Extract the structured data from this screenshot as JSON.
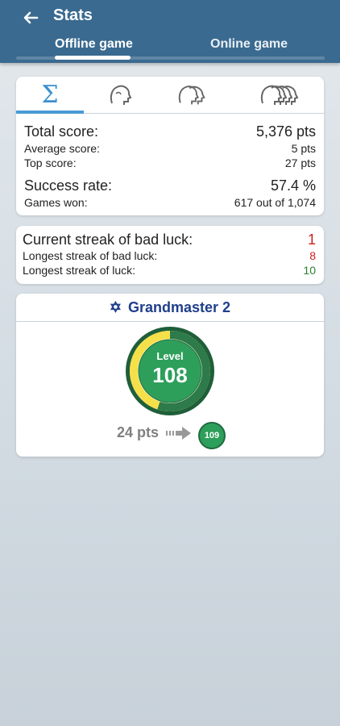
{
  "header": {
    "title": "Stats",
    "tabs": [
      {
        "label": "Offline game",
        "active": true
      },
      {
        "label": "Online game",
        "active": false
      }
    ]
  },
  "stats_tabs": {
    "icons": [
      "sigma-icon",
      "single-head-icon",
      "two-heads-icon",
      "four-heads-icon"
    ],
    "sigma_glyph": "Σ",
    "active_index": 0
  },
  "scores": {
    "total_label": "Total score:",
    "total_value": "5,376 pts",
    "average_label": "Average score:",
    "average_value": "5 pts",
    "top_label": "Top score:",
    "top_value": "27 pts",
    "success_label": "Success rate:",
    "success_value": "57.4 %",
    "games_label": "Games won:",
    "games_value": "617 out of 1,074"
  },
  "streaks": {
    "current_label": "Current streak of bad luck:",
    "current_value": "1",
    "longest_bad_label": "Longest streak of bad luck:",
    "longest_bad_value": "8",
    "longest_luck_label": "Longest streak of luck:",
    "longest_luck_value": "10"
  },
  "rank": {
    "title": "Grandmaster 2",
    "level_label": "Level",
    "level_value": "108",
    "progress_fraction": 0.55,
    "points_to_next": "24 pts",
    "next_level": "109"
  },
  "colors": {
    "header": "#3a6a90",
    "accent_blue": "#3b8fcf",
    "rank_blue": "#1f3f8a",
    "dark_green": "#1f6b3f",
    "green": "#2e9f5b",
    "yellow": "#f5e04a",
    "red": "#cc1f1f"
  }
}
